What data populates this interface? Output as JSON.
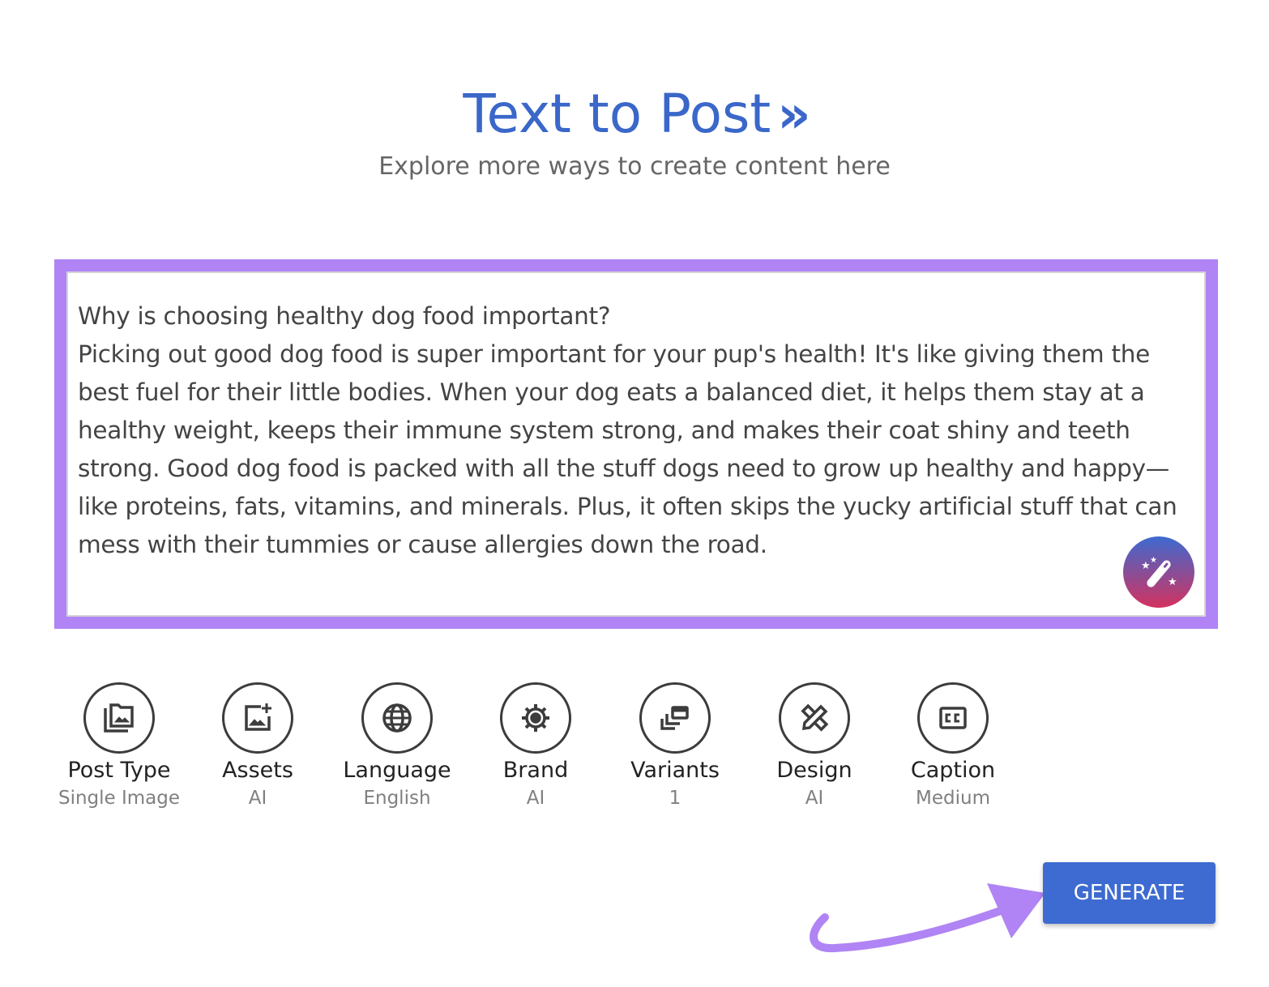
{
  "header": {
    "title": "Text to Post",
    "title_chevron": "»",
    "subtitle": "Explore more ways to create content here"
  },
  "prompt": {
    "text": "Why is choosing healthy dog food important?\nPicking out good dog food is super important for your pup's health! It's like giving them the best fuel for their little bodies. When your dog eats a balanced diet, it helps them stay at a healthy weight, keeps their immune system strong, and makes their coat shiny and teeth strong. Good dog food is packed with all the stuff dogs need to grow up healthy and happy—like proteins, fats, vitamins, and minerals. Plus, it often skips the yucky artificial stuff that can mess with their tummies or cause allergies down the road.",
    "magic_icon": "magic-wand-icon"
  },
  "options": [
    {
      "label": "Post Type",
      "value": "Single Image",
      "icon": "image-folder-icon"
    },
    {
      "label": "Assets",
      "value": "AI",
      "icon": "add-image-icon"
    },
    {
      "label": "Language",
      "value": "English",
      "icon": "globe-icon"
    },
    {
      "label": "Brand",
      "value": "AI",
      "icon": "gear-icon"
    },
    {
      "label": "Variants",
      "value": "1",
      "icon": "stacked-windows-icon"
    },
    {
      "label": "Design",
      "value": "AI",
      "icon": "ruler-pencil-icon"
    },
    {
      "label": "Caption",
      "value": "Medium",
      "icon": "closed-caption-icon"
    }
  ],
  "generate_label": "GENERATE",
  "colors": {
    "accent": "#3a67c9",
    "frame": "#b084f4",
    "button": "#3d6bd1"
  }
}
